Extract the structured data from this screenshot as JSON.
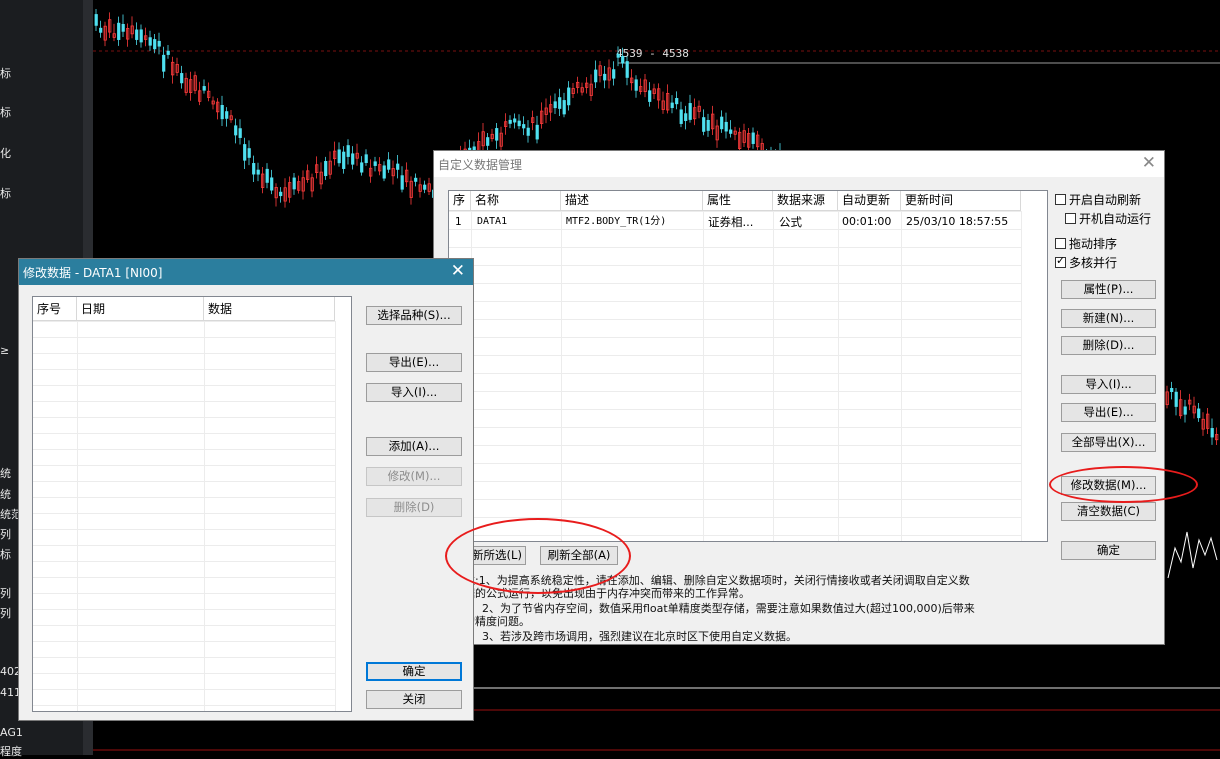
{
  "left_sidebar": {
    "labels": [
      "标",
      "标",
      "化",
      "标",
      "≥",
      "统",
      "统",
      "统范",
      "列",
      "标",
      "列",
      "列",
      "402",
      "411",
      "AG1",
      "程度"
    ]
  },
  "chart": {
    "price_label": "4539 - 4538"
  },
  "custom_data_dialog": {
    "title": "自定义数据管理",
    "columns": [
      "序",
      "名称",
      "描述",
      "属性",
      "数据来源",
      "自动更新",
      "更新时间"
    ],
    "rows": [
      {
        "index": "1",
        "name": "DATA1",
        "desc": "MTF2.BODY_TR(1分)",
        "attr": "证券相...",
        "source": "公式",
        "auto": "00:01:00",
        "time": "25/03/10 18:57:55"
      }
    ],
    "checkboxes": {
      "auto_refresh": {
        "label": "开启自动刷新",
        "checked": false
      },
      "startup_run": {
        "label": "开机自动运行",
        "checked": false
      },
      "drag_sort": {
        "label": "拖动排序",
        "checked": false
      },
      "multi_core": {
        "label": "多核并行",
        "checked": true
      }
    },
    "buttons": {
      "properties": "属性(P)...",
      "new": "新建(N)...",
      "delete": "删除(D)...",
      "import": "导入(I)...",
      "export": "导出(E)...",
      "export_all": "全部导出(X)...",
      "modify_data": "修改数据(M)...",
      "clear_data": "清空数据(C)",
      "ok": "确定",
      "refresh_selected": "新所选(L)",
      "refresh_all": "刷新全部(A)"
    },
    "notes": [
      "注:1、为提高系统稳定性，请在添加、编辑、删除自定义数据项时，关闭行情接收或者关闭调取自定义数",
      "据的公式运行，以免出现由于内存冲突而带来的工作异常。",
      "2、为了节省内存空间，数值采用float单精度类型存储，需要注意如果数值过大(超过100,000)后带来",
      "的精度问题。",
      "3、若涉及跨市场调用，强烈建议在北京时区下使用自定义数据。"
    ]
  },
  "modify_data_dialog": {
    "title": "修改数据 - DATA1 [NI00]",
    "columns": [
      "序号",
      "日期",
      "数据"
    ],
    "buttons": {
      "select_product": "选择品种(S)...",
      "export": "导出(E)...",
      "import": "导入(I)...",
      "add": "添加(A)...",
      "modify": "修改(M)...",
      "delete": "删除(D)",
      "ok": "确定",
      "close": "关闭"
    }
  }
}
